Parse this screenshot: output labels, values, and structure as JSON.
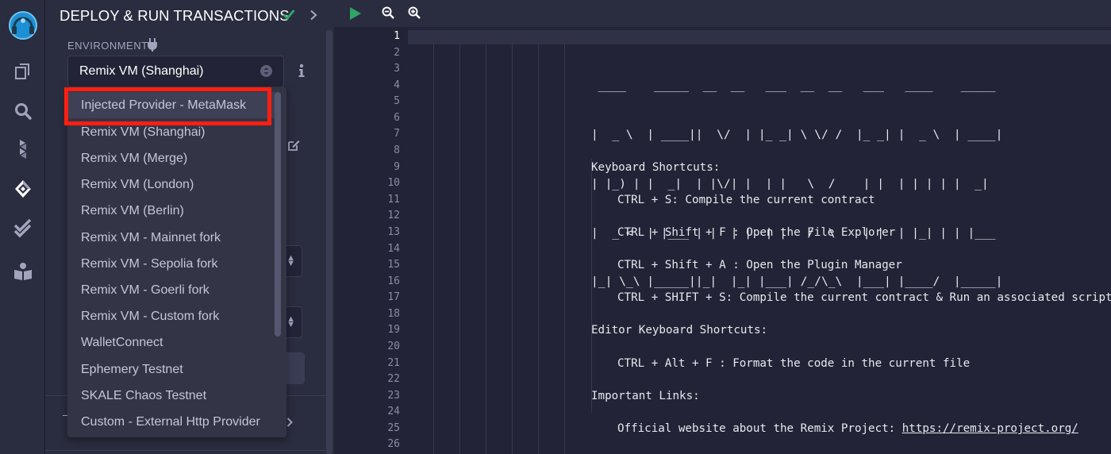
{
  "panel": {
    "title": "DEPLOY & RUN TRANSACTIONS",
    "environment_label": "ENVIRONMENT",
    "selected_environment": "Remix VM (Shanghai)"
  },
  "dropdown": {
    "items": [
      "Injected Provider - MetaMask",
      "Remix VM (Shanghai)",
      "Remix VM (Merge)",
      "Remix VM (London)",
      "Remix VM (Berlin)",
      "Remix VM - Mainnet fork",
      "Remix VM - Sepolia fork",
      "Remix VM - Goerli fork",
      "Remix VM - Custom fork",
      "WalletConnect",
      "Ephemery Testnet",
      "SKALE Chaos Testnet",
      "Custom - External Http Provider"
    ],
    "highlighted_index": 0
  },
  "rail": {
    "icons": [
      "remix-logo-icon",
      "file-explorer-icon",
      "search-icon",
      "solidity-compiler-icon",
      "deploy-run-icon",
      "test-icon",
      "learn-icon"
    ]
  },
  "editor": {
    "line_numbers": [
      "1",
      "2",
      "3",
      "4",
      "5",
      "6",
      "7",
      "8",
      "9",
      "10",
      "11",
      "12",
      "13",
      "14",
      "15",
      "16",
      "17",
      "18",
      "19",
      "20",
      "21",
      "22",
      "23",
      "24",
      "25",
      "26"
    ],
    "active_line": 1,
    "ascii_art": [
      " ____    _____  __  __   ___  __  __   ___   ____    _____",
      "|  _ \\  | ____||  \\/  | |_ _| \\ \\/ /  |_ _| |  _ \\  | ____|",
      "| |_) | |  _|  | |\\/| |  | |   \\  /    | |  | | | | |  _|",
      "|  _ <  | |___ | |  | |  | |   /  \\    | |  | |_| | | |___",
      "|_| \\_\\ |_____||_|  |_| |___| /_/\\_\\  |___| |____/  |_____|"
    ],
    "lines": {
      "l9": "Keyboard Shortcuts:",
      "l11": "CTRL + S: Compile the current contract",
      "l13": "CTRL + Shift + F : Open the File Explorer",
      "l15": "CTRL + Shift + A : Open the Plugin Manager",
      "l17": "CTRL + SHIFT + S: Compile the current contract & Run an associated script",
      "l19": "Editor Keyboard Shortcuts:",
      "l21": "CTRL + Alt + F : Format the code in the current file",
      "l23": "Important Links:",
      "l25_prefix": "Official website about the Remix Project: ",
      "l25_link": "https://remix-project.org/"
    }
  },
  "colors": {
    "background": "#222336",
    "panel": "#2a2c3f",
    "accent_green": "#2ea466",
    "highlight_red": "#ff1f10",
    "text_light": "#ffffff"
  }
}
